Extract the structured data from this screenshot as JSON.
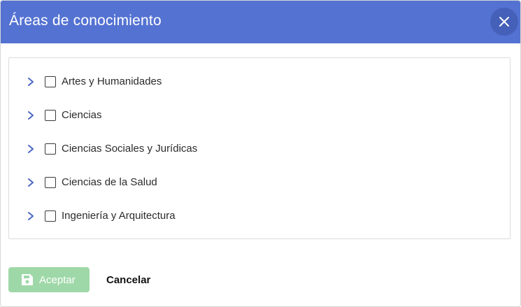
{
  "dialog": {
    "title": "Áreas de conocimiento",
    "header_color": "#5472d2",
    "close_icon": "close-icon"
  },
  "tree": {
    "items": [
      {
        "label": "Artes y Humanidades",
        "expand_icon": "chevron-right-icon",
        "checked": false
      },
      {
        "label": "Ciencias",
        "expand_icon": "chevron-right-icon",
        "checked": false
      },
      {
        "label": "Ciencias Sociales y Jurídicas",
        "expand_icon": "chevron-right-icon",
        "checked": false
      },
      {
        "label": "Ciencias de la Salud",
        "expand_icon": "chevron-right-icon",
        "checked": false
      },
      {
        "label": "Ingeniería y Arquitectura",
        "expand_icon": "chevron-right-icon",
        "checked": false
      }
    ],
    "chevron_color": "#4a67c4"
  },
  "footer": {
    "accept_label": "Aceptar",
    "accept_icon": "save-icon",
    "accept_color": "#9fd8a8",
    "accept_disabled": true,
    "cancel_label": "Cancelar"
  }
}
